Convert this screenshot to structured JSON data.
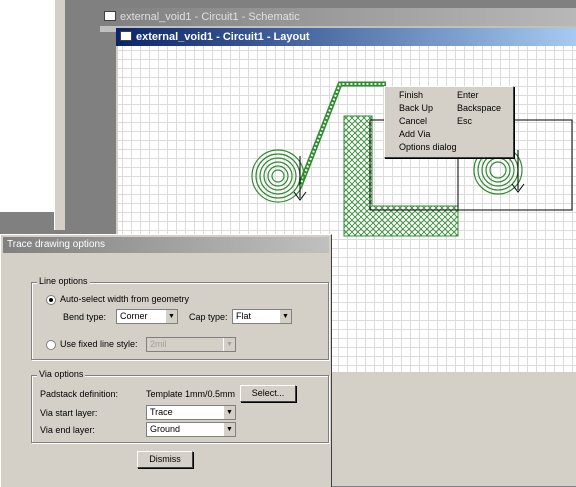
{
  "schematic_window": {
    "title": "external_void1 - Circuit1 - Schematic"
  },
  "layout_window": {
    "title": "external_void1 - Circuit1 - Layout"
  },
  "context_menu": {
    "items": [
      {
        "label": "Finish",
        "shortcut": "Enter"
      },
      {
        "label": "Back Up",
        "shortcut": "Backspace"
      },
      {
        "label": "Cancel",
        "shortcut": "Esc"
      },
      {
        "label": "Add Via",
        "shortcut": ""
      },
      {
        "label": "Options dialog",
        "shortcut": ""
      }
    ]
  },
  "dialog": {
    "title": "Trace drawing options",
    "line_options": {
      "legend": "Line options",
      "auto_select_label": "Auto-select width from geometry",
      "bend_type_label": "Bend type:",
      "bend_type_value": "Corner",
      "cap_type_label": "Cap type:",
      "cap_type_value": "Flat",
      "fixed_style_label": "Use fixed line style:",
      "fixed_style_value": "2mil"
    },
    "via_options": {
      "legend": "Via options",
      "padstack_label": "Padstack definition:",
      "padstack_value": "Template 1mm/0.5mm",
      "select_button": "Select...",
      "start_layer_label": "Via start layer:",
      "start_layer_value": "Trace",
      "end_layer_label": "Via end layer:",
      "end_layer_value": "Ground"
    },
    "dismiss_button": "Dismiss"
  },
  "colors": {
    "trace_green": "#2e8b2e",
    "hatch_green": "#4caf50",
    "title_active": "#0a246a"
  },
  "icons": [
    "window-icon",
    "dropdown-arrow-icon",
    "radio-button"
  ]
}
